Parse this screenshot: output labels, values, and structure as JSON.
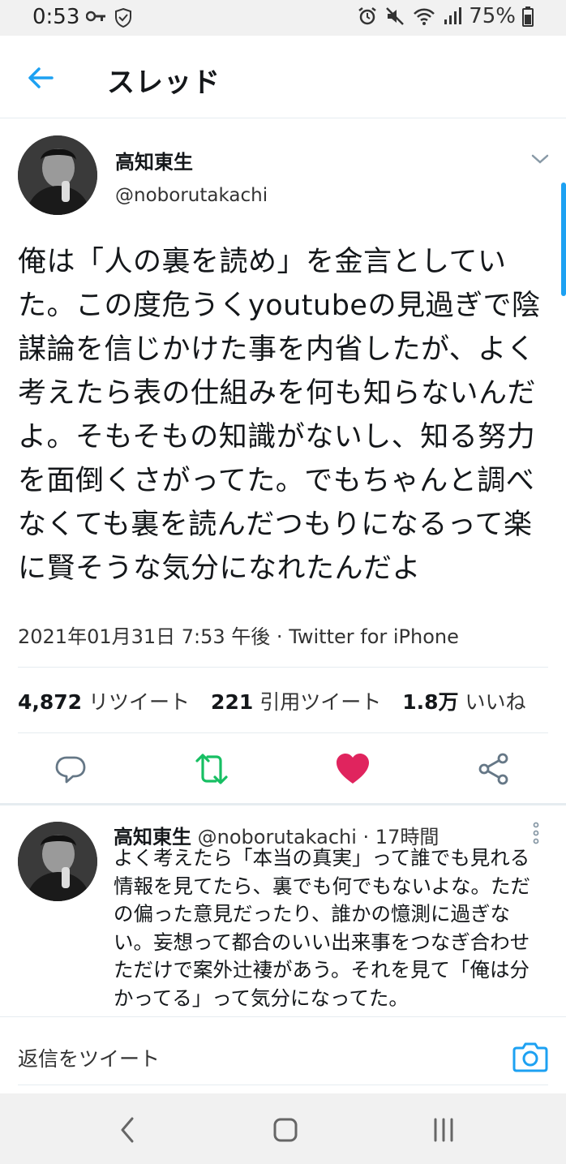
{
  "status_bar": {
    "time": "0:53",
    "battery": "75%"
  },
  "header": {
    "title": "スレッド"
  },
  "tweet": {
    "name": "高知東生",
    "handle": "@noborutakachi",
    "text": "俺は「人の裏を読め」を金言としていた。この度危うくyoutubeの見過ぎで陰謀論を信じかけた事を内省したが、よく考えたら表の仕組みを何も知らないんだよ。そもそもの知識がないし、知る努力を面倒くさがってた。でもちゃんと調べなくても裏を読んだつもりになるって楽に賢そうな気分になれたんだよ",
    "meta": "2021年01月31日 7:53 午後 · Twitter for iPhone",
    "retweets_count": "4,872",
    "retweets_label": "リツイート",
    "quotes_count": "221",
    "quotes_label": "引用ツイート",
    "likes_count": "1.8万",
    "likes_label": "いいね"
  },
  "reply": {
    "name": "高知東生",
    "handle": "@noborutakachi",
    "time": "· 17時間",
    "text": "よく考えたら「本当の真実」って誰でも見れる情報を見てたら、裏でも何でもないよな。ただの偏った意見だったり、誰かの憶測に過ぎない。妄想って都合のいい出来事をつなぎ合わせただけで案外辻褄があう。それを見て「俺は分かってる」って気分になってた。"
  },
  "compose": {
    "placeholder": "返信をツイート"
  },
  "colors": {
    "accent": "#1da1f2",
    "retweet": "#17bf63",
    "like": "#e0245e",
    "icon_gray": "#657786"
  },
  "icons": [
    "key-icon",
    "shield-icon",
    "alarm-icon",
    "mute-icon",
    "wifi-icon",
    "signal-icon",
    "battery-icon",
    "back-arrow-icon",
    "chevron-down-icon",
    "reply-icon",
    "retweet-icon",
    "heart-icon",
    "share-icon",
    "more-vertical-icon",
    "camera-icon",
    "nav-back-icon",
    "nav-home-icon",
    "nav-recents-icon"
  ]
}
